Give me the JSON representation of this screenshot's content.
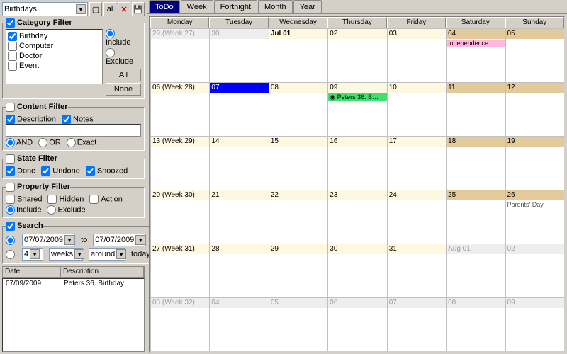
{
  "toolbar": {
    "selector_value": "Birthdays",
    "btn_new": "▢",
    "btn_al": "al",
    "btn_del": "✕",
    "btn_save": "💾"
  },
  "category_filter": {
    "title_label": "Category Filter",
    "enabled": true,
    "items": [
      {
        "label": "Birthday",
        "checked": true
      },
      {
        "label": "Computer",
        "checked": false
      },
      {
        "label": "Doctor",
        "checked": false
      },
      {
        "label": "Event",
        "checked": false
      }
    ],
    "include_label": "Include",
    "exclude_label": "Exclude",
    "mode": "include",
    "btn_all": "All",
    "btn_none": "None"
  },
  "content_filter": {
    "title_label": "Content Filter",
    "enabled": false,
    "description_label": "Description",
    "description": true,
    "notes_label": "Notes",
    "notes": true,
    "text": "",
    "and_label": "AND",
    "or_label": "OR",
    "exact_label": "Exact",
    "mode": "AND"
  },
  "state_filter": {
    "title_label": "State Filter",
    "enabled": false,
    "done_label": "Done",
    "done": true,
    "undone_label": "Undone",
    "undone": true,
    "snoozed_label": "Snoozed",
    "snoozed": true
  },
  "property_filter": {
    "title_label": "Property Filter",
    "enabled": false,
    "shared_label": "Shared",
    "shared": false,
    "hidden_label": "Hidden",
    "hidden": false,
    "action_label": "Action",
    "action": false,
    "include_label": "Include",
    "exclude_label": "Exclude",
    "mode": "include"
  },
  "search": {
    "title_label": "Search",
    "enabled": true,
    "from": "07/07/2009",
    "to_label": "to",
    "to": "07/07/2009",
    "count": "4",
    "unit": "weeks",
    "rel": "around",
    "today_label": "today"
  },
  "results": {
    "col_date": "Date",
    "col_desc": "Description",
    "rows": [
      {
        "date": "07/09/2009",
        "desc": "Peters 36. Birthday"
      }
    ]
  },
  "view_tabs": [
    "ToDo",
    "Week",
    "Fortnight",
    "Month",
    "Year"
  ],
  "view_active": "Month",
  "calendar": {
    "day_headers": [
      "Monday",
      "Tuesday",
      "Wednesday",
      "Thursday",
      "Friday",
      "Saturday",
      "Sunday"
    ],
    "weeks": [
      {
        "cells": [
          {
            "label": "29 (Week 27)",
            "out": true
          },
          {
            "label": "30",
            "out": true
          },
          {
            "label": "Jul 01",
            "bold": true
          },
          {
            "label": "02"
          },
          {
            "label": "03"
          },
          {
            "label": "04",
            "wkend": true,
            "event": {
              "text": "Independence …",
              "cls": "pink"
            }
          },
          {
            "label": "05",
            "wkend": true
          }
        ]
      },
      {
        "cells": [
          {
            "label": "06 (Week 28)"
          },
          {
            "label": "07",
            "today": true
          },
          {
            "label": "08"
          },
          {
            "label": "09",
            "event": {
              "text": "Peters 36. B…",
              "cls": "green"
            }
          },
          {
            "label": "10"
          },
          {
            "label": "11",
            "wkend": true
          },
          {
            "label": "12",
            "wkend": true
          }
        ]
      },
      {
        "cells": [
          {
            "label": "13 (Week 29)"
          },
          {
            "label": "14"
          },
          {
            "label": "15"
          },
          {
            "label": "16"
          },
          {
            "label": "17"
          },
          {
            "label": "18",
            "wkend": true
          },
          {
            "label": "19",
            "wkend": true
          }
        ]
      },
      {
        "cells": [
          {
            "label": "20 (Week 30)"
          },
          {
            "label": "21"
          },
          {
            "label": "22"
          },
          {
            "label": "23"
          },
          {
            "label": "24"
          },
          {
            "label": "25",
            "wkend": true
          },
          {
            "label": "26",
            "wkend": true,
            "event": {
              "text": "Parents' Day",
              "cls": "grey"
            }
          }
        ]
      },
      {
        "cells": [
          {
            "label": "27 (Week 31)"
          },
          {
            "label": "28"
          },
          {
            "label": "29"
          },
          {
            "label": "30"
          },
          {
            "label": "31"
          },
          {
            "label": "Aug 01",
            "wkend": true,
            "out": true
          },
          {
            "label": "02",
            "wkend": true,
            "out": true
          }
        ]
      },
      {
        "cells": [
          {
            "label": "03 (Week 32)",
            "out": true
          },
          {
            "label": "04",
            "out": true
          },
          {
            "label": "05",
            "out": true
          },
          {
            "label": "06",
            "out": true
          },
          {
            "label": "07",
            "out": true
          },
          {
            "label": "08",
            "wkend": true,
            "out": true
          },
          {
            "label": "09",
            "wkend": true,
            "out": true
          }
        ]
      }
    ]
  }
}
